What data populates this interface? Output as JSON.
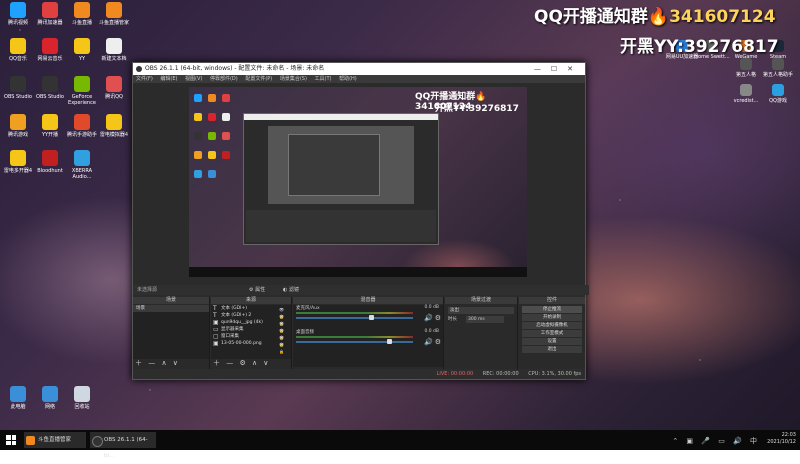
{
  "overlay": {
    "line1_text": "QQ开播通知群🔥",
    "line1_num": "341607124",
    "line2": "开黑YY:39276817"
  },
  "desktop_icons_left": [
    {
      "label": "腾讯视频",
      "color": "#1fa2ff"
    },
    {
      "label": "腾讯加速器",
      "color": "#e04040"
    },
    {
      "label": "斗鱼直播",
      "color": "#f08a20"
    },
    {
      "label": "斗鱼直播管家",
      "color": "#f08a20"
    },
    {
      "label": "QQ音乐",
      "color": "#f5c518"
    },
    {
      "label": "网易云音乐",
      "color": "#d9232d"
    },
    {
      "label": "YY",
      "color": "#f5c518"
    },
    {
      "label": "新建文本档",
      "color": "#eeeeee"
    },
    {
      "label": "OBS Studio",
      "color": "#333333"
    },
    {
      "label": "OBS Studio",
      "color": "#333333"
    },
    {
      "label": "GeForce Experience",
      "color": "#76b900"
    },
    {
      "label": "腾讯QQ",
      "color": "#e05050"
    },
    {
      "label": "腾讯游戏",
      "color": "#f0a020"
    },
    {
      "label": "YY开播",
      "color": "#f5c518"
    },
    {
      "label": "腾讯手游助手",
      "color": "#e04a2a"
    },
    {
      "label": "雷电模拟器4",
      "color": "#f5c518"
    },
    {
      "label": "雷电多开器4",
      "color": "#f5c518"
    },
    {
      "label": "Bloodhunt",
      "color": "#c02020"
    },
    {
      "label": "XBERRA Audio...",
      "color": "#30a0e0"
    },
    {
      "label": "此电脑",
      "color": "#3a8fd8"
    },
    {
      "label": "网络",
      "color": "#3a8fd8"
    },
    {
      "label": "回收站",
      "color": "#cfd8e0"
    }
  ],
  "desktop_icons_right": [
    {
      "label": "网易UU加速器",
      "color": "#2a7ad8"
    },
    {
      "label": "Home Swett...",
      "color": "#666666"
    },
    {
      "label": "WeGame",
      "color": "#e07020"
    },
    {
      "label": "Steam",
      "color": "#1b2838"
    },
    {
      "label": "第五人格",
      "color": "#555555"
    },
    {
      "label": "第五人格助手",
      "color": "#555555"
    },
    {
      "label": "vcredist...",
      "color": "#888888"
    },
    {
      "label": "QQ游戏",
      "color": "#2aa0e0"
    }
  ],
  "obs": {
    "title": "OBS 26.1.1 (64-bit, windows) - 配置文件: 未命名 - 场景: 未命名",
    "menu": [
      "文件(F)",
      "编辑(E)",
      "视图(V)",
      "停靠部件(D)",
      "配置文件(P)",
      "场景集合(S)",
      "工具(T)",
      "帮助(H)"
    ],
    "scene_label": "未选择源",
    "props_button": "属性",
    "filters_button": "滤镜",
    "docks": {
      "scenes": {
        "title": "场景",
        "items": [
          "场景"
        ]
      },
      "sources": {
        "title": "来源",
        "items": [
          {
            "name": "文本 (GDI+)",
            "type": "text"
          },
          {
            "name": "文本 (GDI+) 2",
            "type": "text"
          },
          {
            "name": "qun9dqu__jpg (4k)",
            "type": "image"
          },
          {
            "name": "显示器采集",
            "type": "monitor"
          },
          {
            "name": "窗口采集",
            "type": "window"
          },
          {
            "name": "13-05-00-000.png",
            "type": "image"
          }
        ]
      },
      "mixer": {
        "title": "混音器",
        "channels": [
          {
            "name": "麦克风/Aux",
            "db": "0.0 dB",
            "level": 0.62
          },
          {
            "name": "桌面音频",
            "db": "0.0 dB",
            "level": 0.78
          }
        ]
      },
      "transitions": {
        "title": "场景过渡",
        "type": "淡出",
        "duration_label": "时长",
        "duration": "300 ms"
      },
      "controls": {
        "title": "控件",
        "buttons": [
          "停止推流",
          "开始录制",
          "启动虚拟摄像机",
          "工作室模式",
          "设置",
          "退出"
        ]
      }
    },
    "status": {
      "live": "LIVE: 00:00:00",
      "rec": "REC: 00:00:00",
      "cpu": "CPU: 3.1%, 30.00 fps"
    }
  },
  "taskbar": {
    "apps": [
      {
        "label": "斗鱼直播管家",
        "color": "#f08a20"
      },
      {
        "label": "OBS 26.1.1 (64-bi...",
        "color": "#333333"
      }
    ],
    "time": "22:03",
    "date": "2021/10/12"
  }
}
